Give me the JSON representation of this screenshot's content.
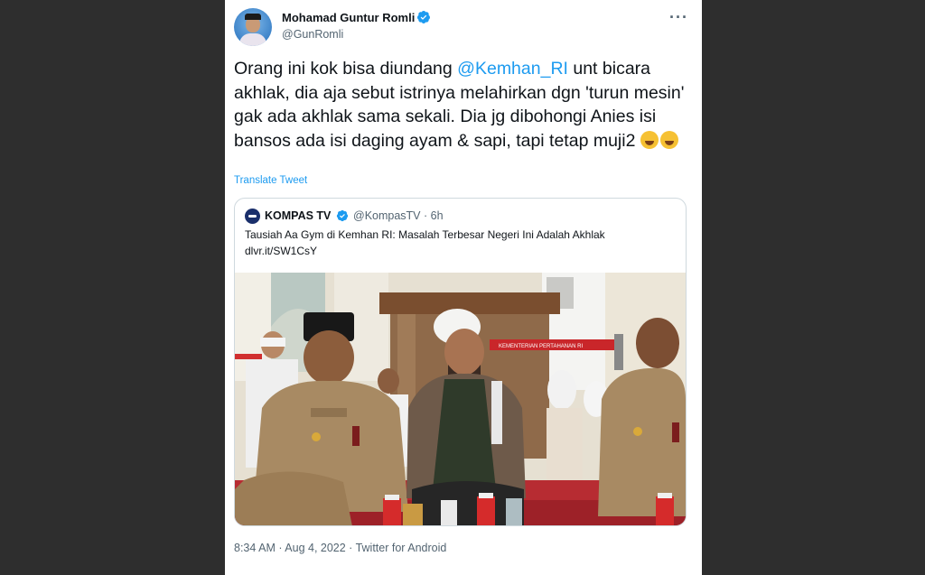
{
  "tweet": {
    "author_name": "Mohamad Guntur Romli",
    "author_handle": "@GunRomli",
    "text_part1": "Orang ini kok bisa diundang ",
    "mention": "@Kemhan_RI",
    "text_part2": " unt bicara akhlak, dia aja sebut istrinya melahirkan dgn 'turun mesin' gak ada akhlak sama sekali. Dia jg dibohongi Anies isi bansos ada isi daging ayam & sapi, tapi tetap muji2 ",
    "emojis": [
      "rolling-on-floor-laughing",
      "tears-of-joy"
    ],
    "translate_label": "Translate Tweet",
    "more_label": "···",
    "footer_meta": "8:34 AM · Aug 4, 2022 · Twitter for Android"
  },
  "quoted": {
    "author_name": "KOMPAS TV",
    "handle_time": "@KompasTV · 6h",
    "line1": "Tausiah Aa Gym di Kemhan RI: Masalah Terbesar Negeri Ini Adalah Akhlak",
    "line2": "dlvr.it/SW1CsY",
    "banner_text": "KEMENTERIAN PERTAHANAN RI"
  },
  "colors": {
    "accent": "#1d9bf0",
    "text": "#0f1419",
    "muted": "#536471",
    "border": "#cfd9de"
  }
}
